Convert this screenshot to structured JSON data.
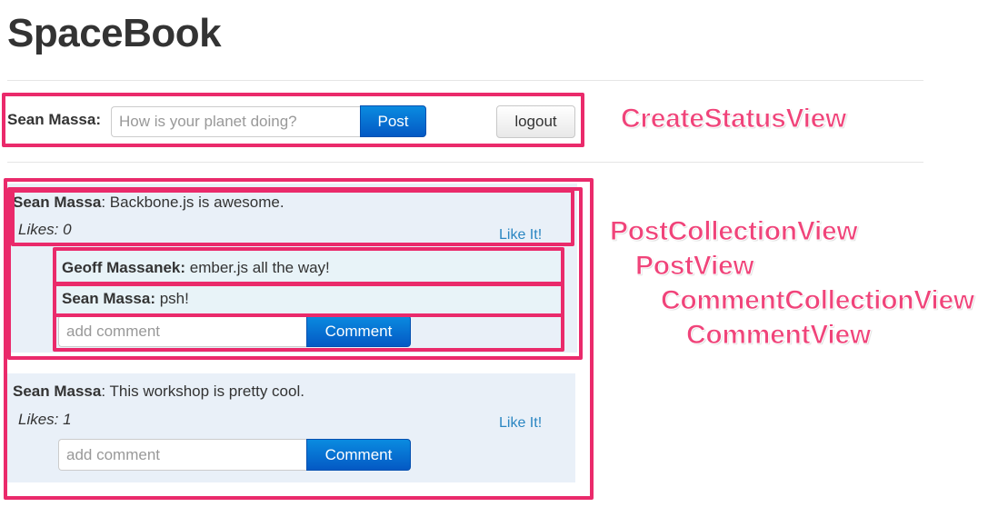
{
  "app": {
    "title": "SpaceBook"
  },
  "status_form": {
    "user": "Sean Massa:",
    "placeholder": "How is your planet doing?",
    "post_label": "Post",
    "logout_label": "logout"
  },
  "posts": [
    {
      "author": "Sean Massa",
      "text": ": Backbone.js is awesome.",
      "likes": "Likes: 0",
      "like_label": "Like It!",
      "comments": [
        {
          "author": "Geoff Massanek:",
          "text": " ember.js all the way!"
        },
        {
          "author": "Sean Massa:",
          "text": " psh!"
        }
      ],
      "comment_placeholder": "add comment",
      "comment_label": "Comment"
    },
    {
      "author": "Sean Massa",
      "text": ": This workshop is pretty cool.",
      "likes": "Likes: 1",
      "like_label": "Like It!",
      "comments": [],
      "comment_placeholder": "add comment",
      "comment_label": "Comment"
    }
  ],
  "annotations": {
    "create_status_view": "CreateStatusView",
    "post_collection_view": "PostCollectionView",
    "post_view": "PostView",
    "comment_collection_view": "CommentCollectionView",
    "comment_view": "CommentView"
  },
  "colors": {
    "annotation": "#ea2a6b",
    "primary_button": "#0459c4",
    "link": "#2a86c2",
    "post_background": "#e9f0f8"
  }
}
